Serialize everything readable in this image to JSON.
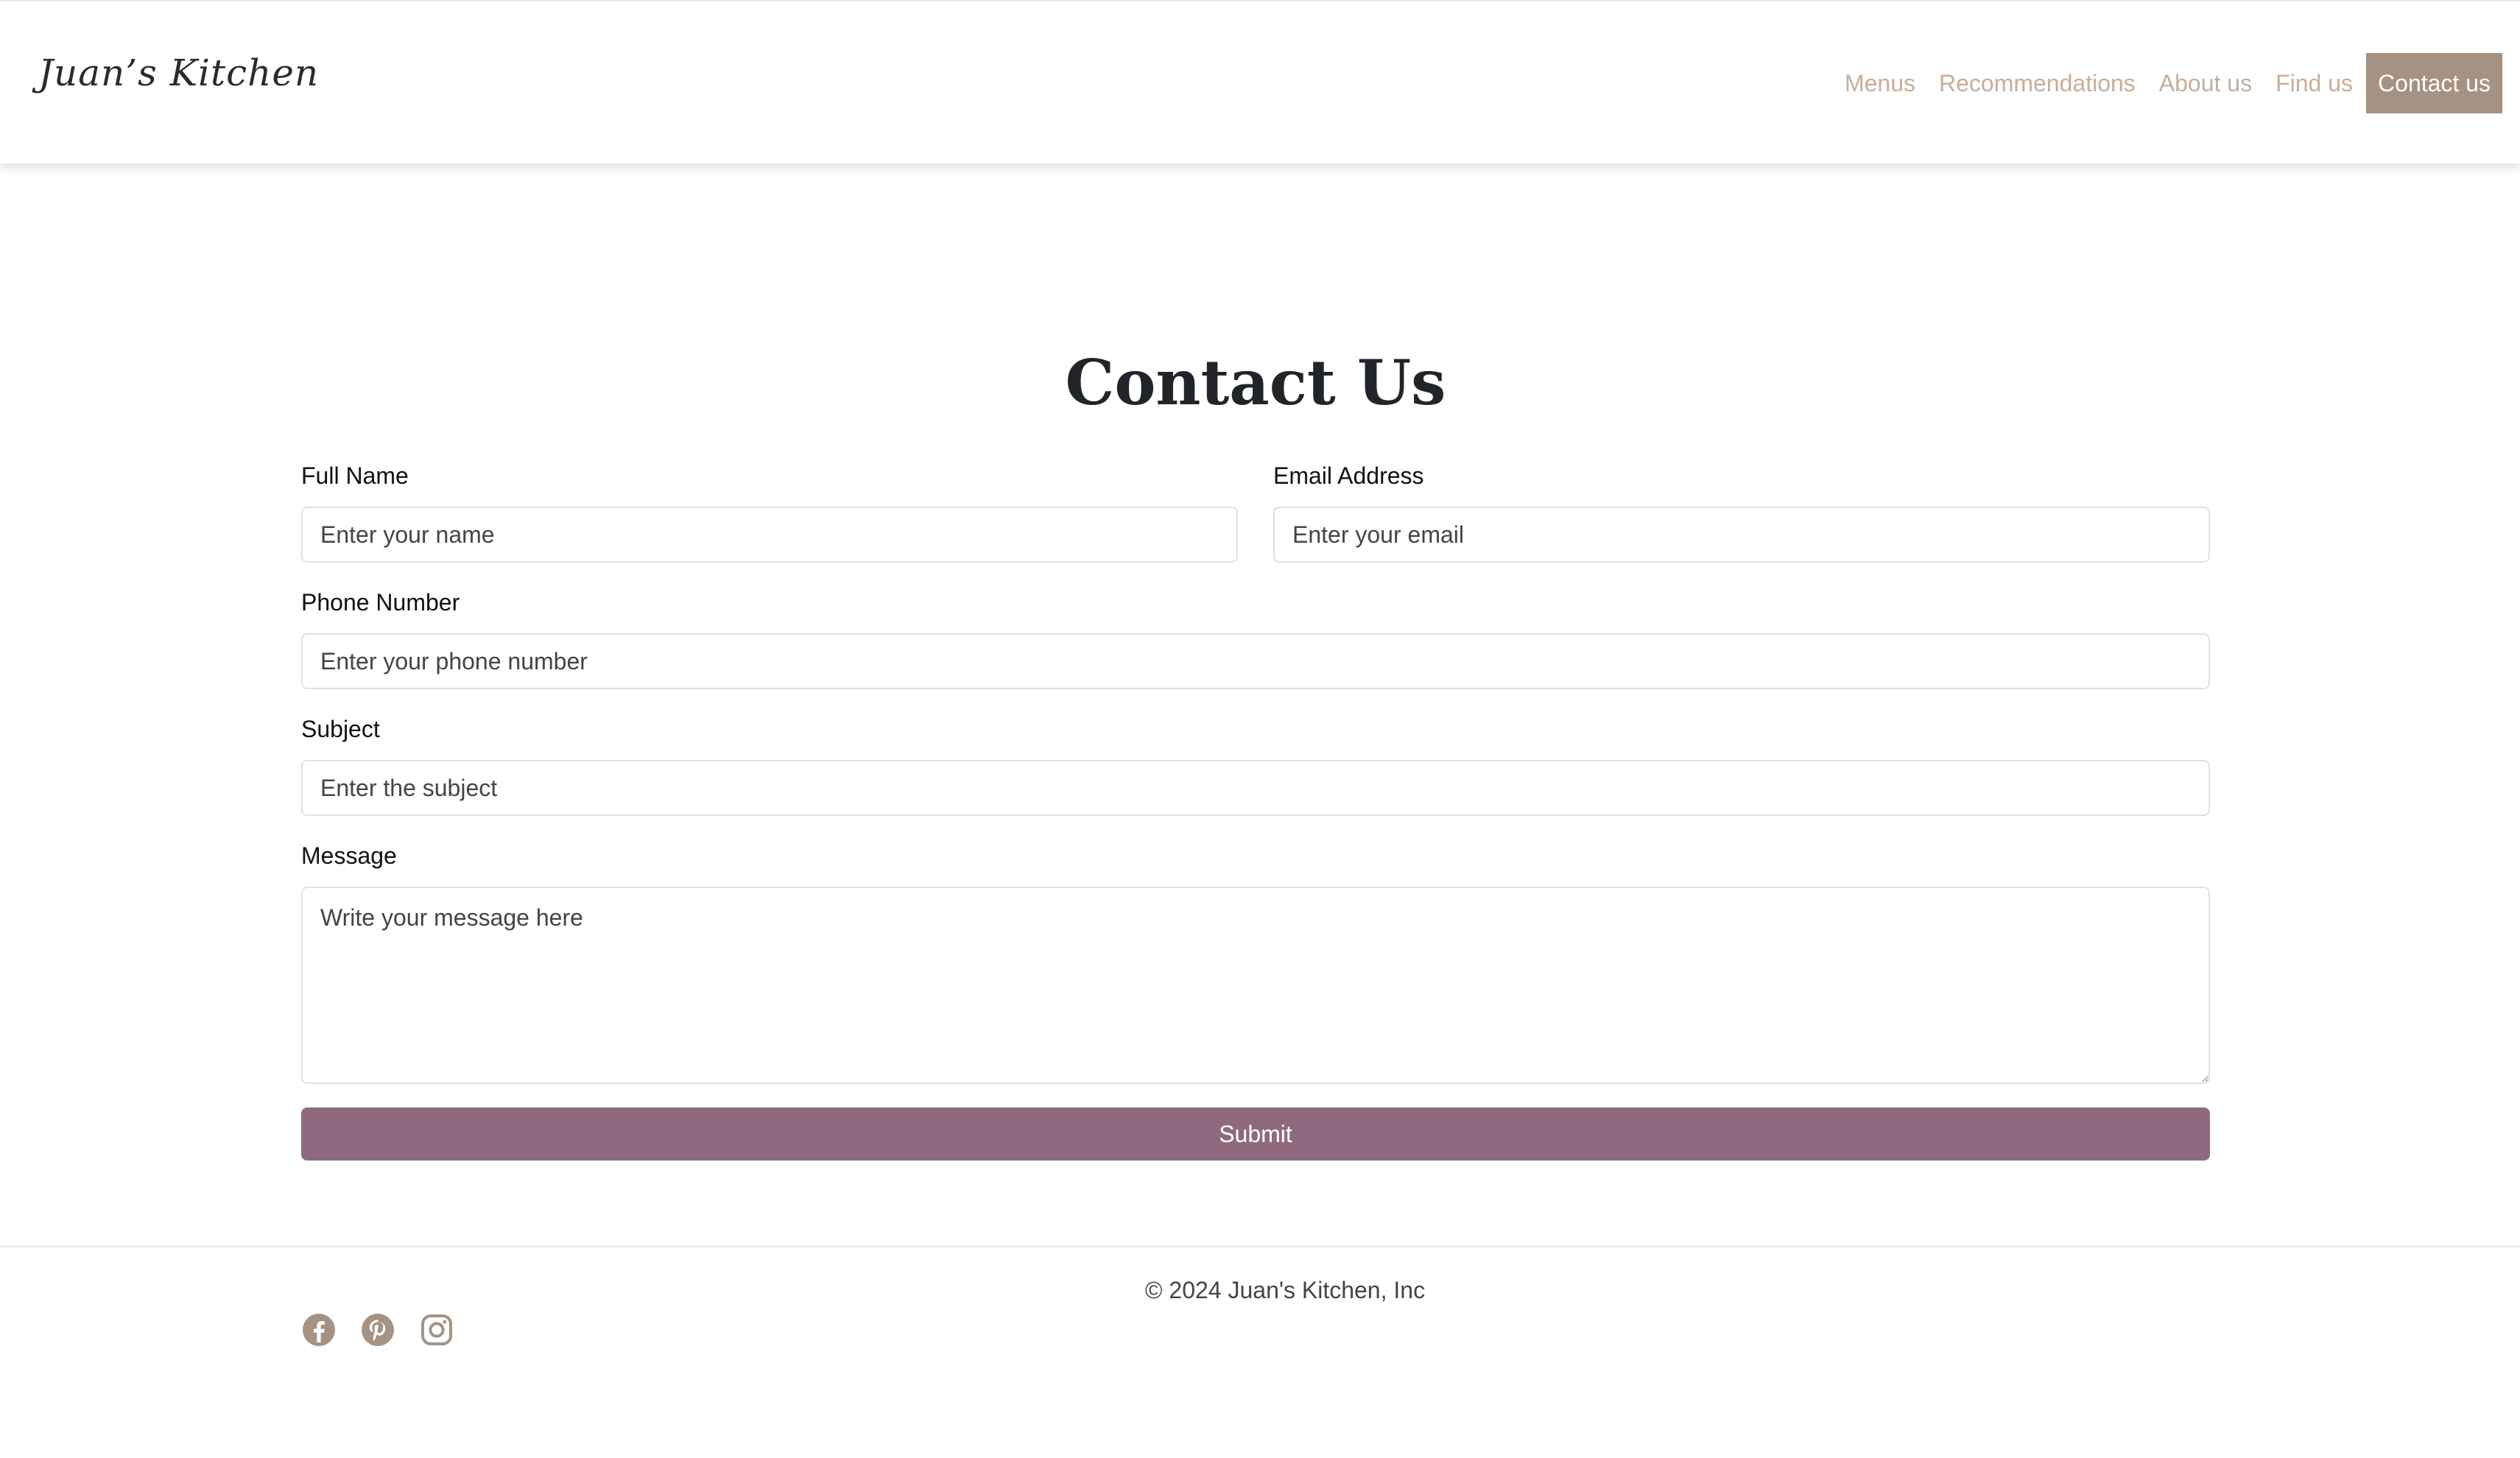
{
  "brand": {
    "name": "Juan’s Kitchen"
  },
  "nav": {
    "items": [
      {
        "label": "Menus"
      },
      {
        "label": "Recommendations"
      },
      {
        "label": "About us"
      },
      {
        "label": "Find us"
      },
      {
        "label": "Contact us",
        "active": true
      }
    ]
  },
  "form": {
    "title": "Contact Us",
    "full_name": {
      "label": "Full Name",
      "placeholder": "Enter your name",
      "value": ""
    },
    "email": {
      "label": "Email Address",
      "placeholder": "Enter your email",
      "value": ""
    },
    "phone": {
      "label": "Phone Number",
      "placeholder": "Enter your phone number",
      "value": ""
    },
    "subject": {
      "label": "Subject",
      "placeholder": "Enter the subject",
      "value": ""
    },
    "message": {
      "label": "Message",
      "placeholder": "Write your message here",
      "value": ""
    },
    "submit_label": "Submit"
  },
  "footer": {
    "copyright": "© 2024 Juan's Kitchen, Inc",
    "socials": [
      {
        "icon": "facebook-icon"
      },
      {
        "icon": "pinterest-icon"
      },
      {
        "icon": "instagram-icon"
      }
    ]
  },
  "colors": {
    "accent": "#a69282",
    "nav_link": "#c8ad98",
    "submit": "#8f6a7e",
    "social_icon": "#a69282"
  }
}
